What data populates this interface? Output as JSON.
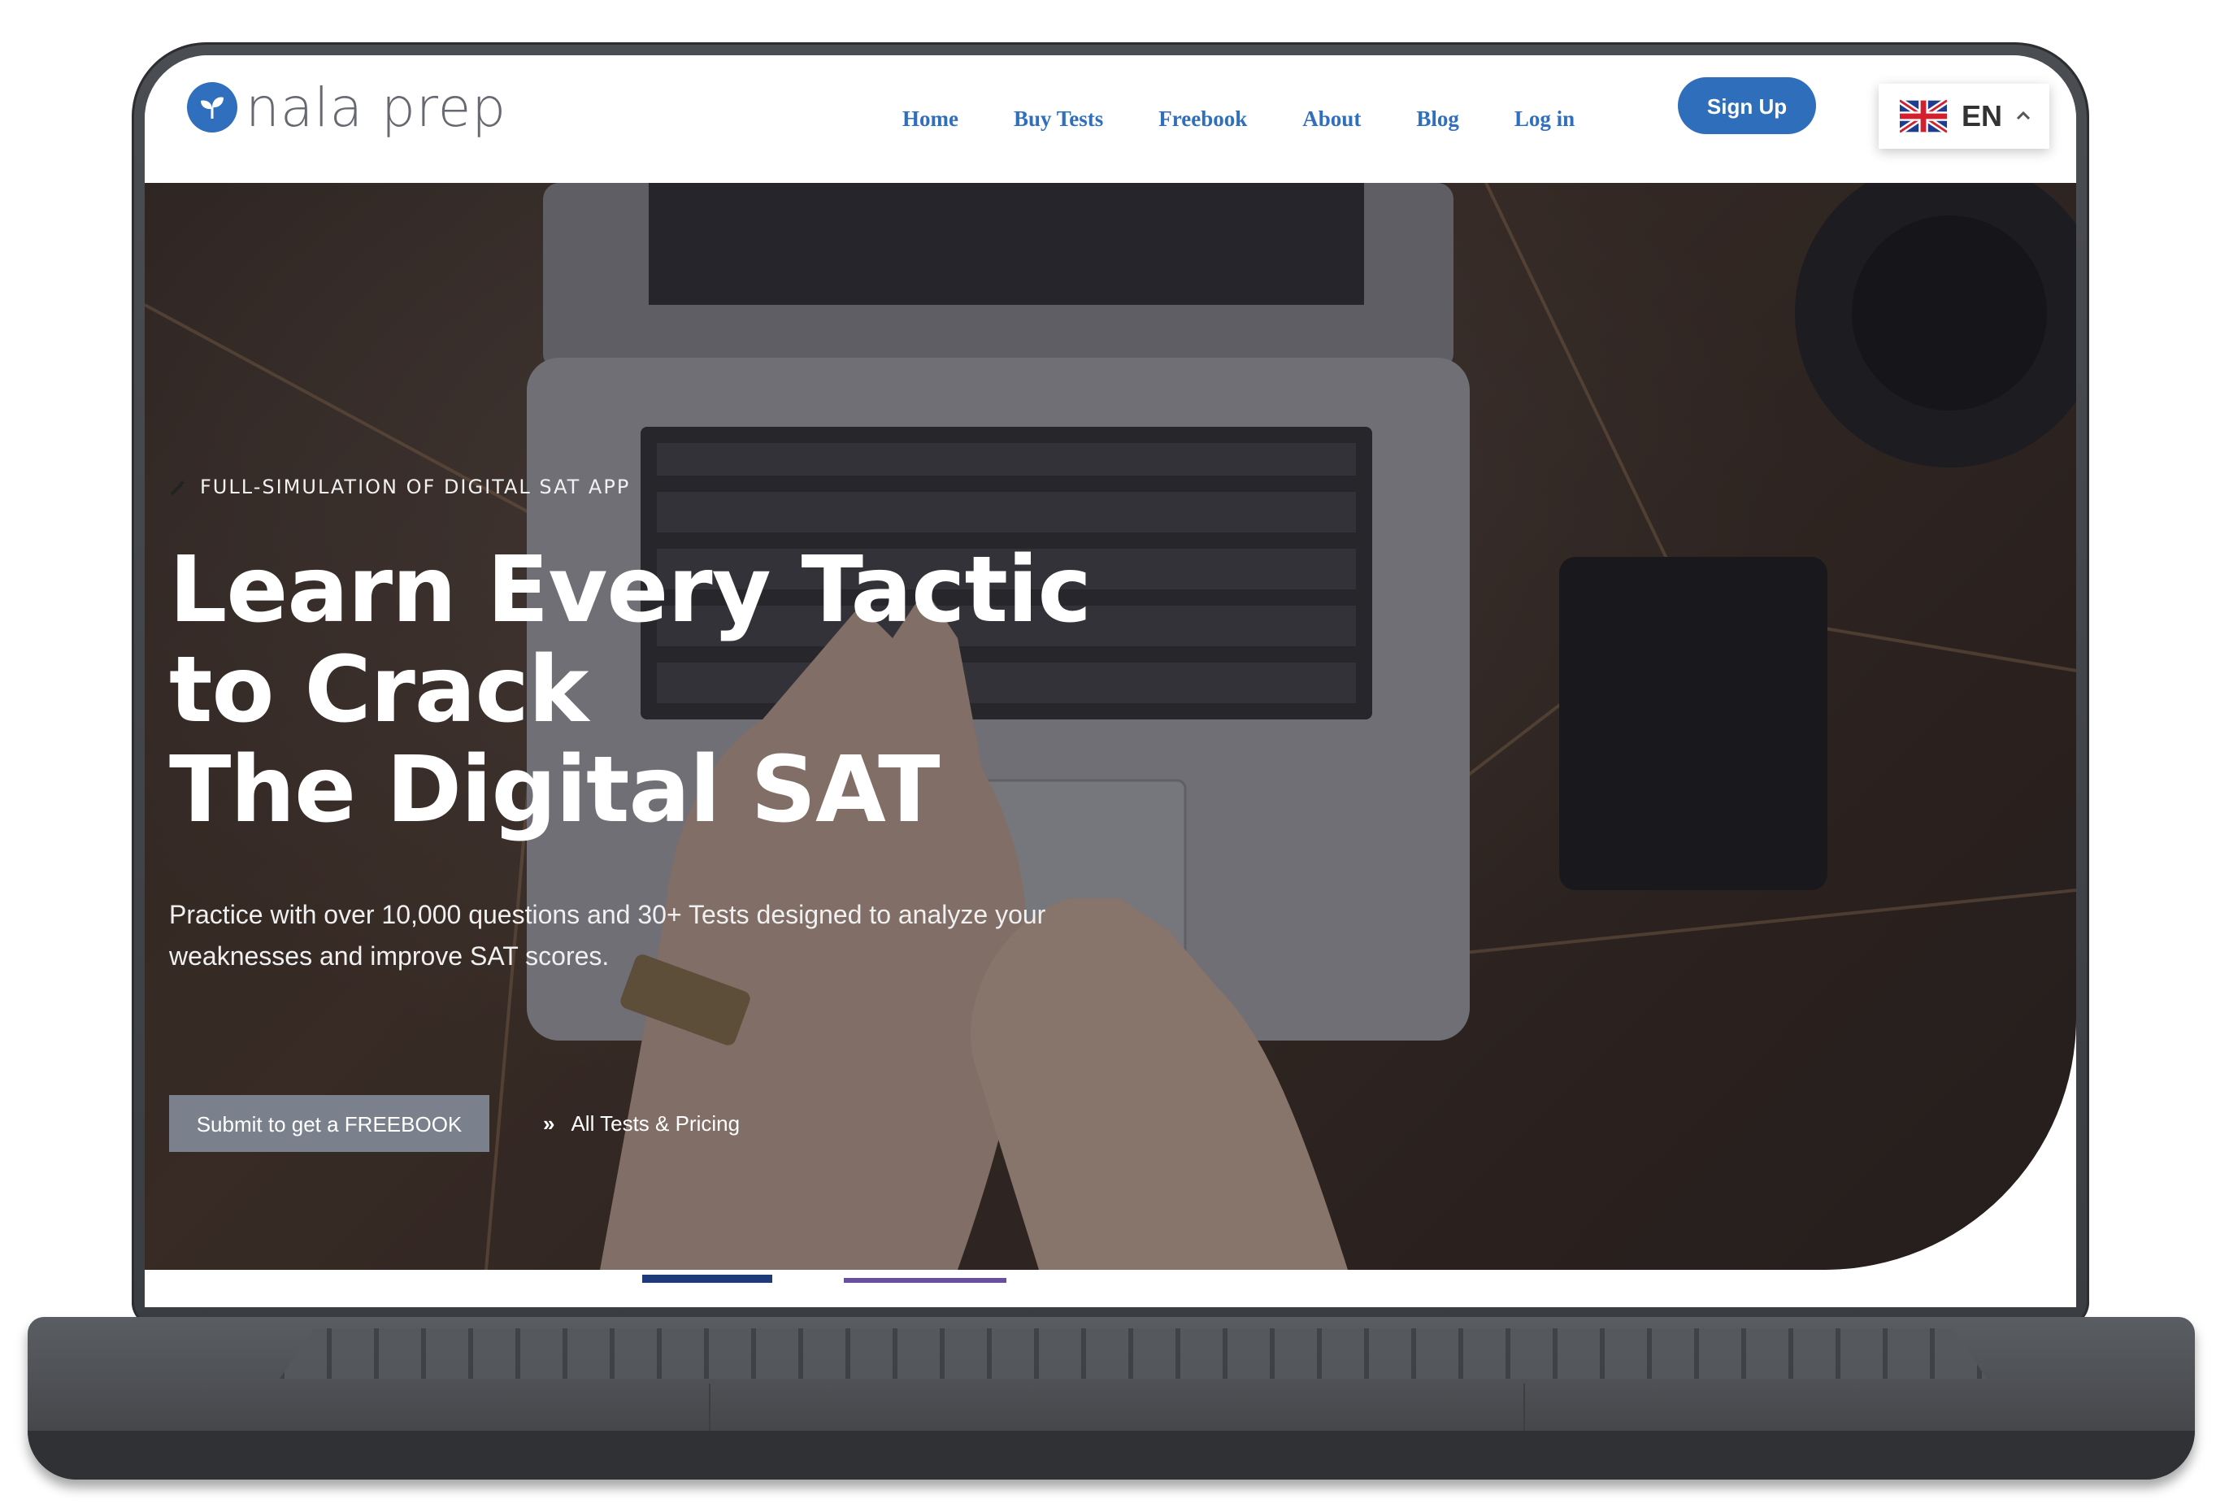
{
  "nav": {
    "logo_text": "nala prep",
    "links": [
      {
        "label": "Home",
        "active": true
      },
      {
        "label": "Buy Tests",
        "active": false
      },
      {
        "label": "Freebook",
        "active": false
      },
      {
        "label": "About",
        "active": false
      },
      {
        "label": "Blog",
        "active": false
      },
      {
        "label": "Log in",
        "active": false
      }
    ],
    "signup_label": "Sign Up",
    "language": {
      "code": "EN",
      "flag": "uk-flag-icon",
      "chevron": "chevron-up-icon"
    }
  },
  "hero": {
    "eyebrow": "FULL-SIMULATION OF DIGITAL SAT APP",
    "headline_lines": [
      "Learn Every Tactic",
      "to Crack",
      "The Digital SAT"
    ],
    "subtext": "Practice with over 10,000 questions and 30+ Tests designed to analyze your weaknesses and improve SAT scores.",
    "cta_label": "Submit to get a FREEBOOK",
    "secondary_link": "All Tests & Pricing"
  },
  "colors": {
    "brand_blue": "#2f6fbe",
    "cta_gray": "#7a808c",
    "nav_text": "#2f6fbe",
    "laptop_body": "#3a3d42"
  }
}
